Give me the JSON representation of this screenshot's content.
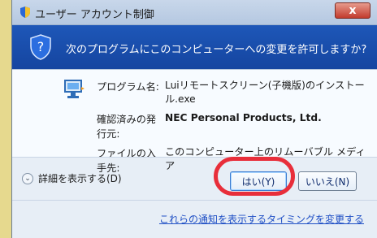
{
  "window": {
    "title": "ユーザー アカウント制御",
    "close_label": "x"
  },
  "header": {
    "text": "次のプログラムにこのコンピューターへの変更を許可しますか?"
  },
  "details": {
    "program_label": "プログラム名:",
    "program_value": "Luiリモートスクリーン(子機版)のインストール.exe",
    "publisher_label": "確認済みの発行元:",
    "publisher_value": "NEC Personal Products, Ltd.",
    "source_label": "ファイルの入手先:",
    "source_value": "このコンピューター上のリムーバブル メディア"
  },
  "actions": {
    "show_details": "詳細を表示する(D)",
    "yes": "はい(Y)",
    "no": "いいえ(N)"
  },
  "footer": {
    "link": "これらの通知を表示するタイミングを変更する"
  },
  "colors": {
    "header_blue": "#1b4fae",
    "highlight_red": "#e82e3a",
    "link_blue": "#1f4fc5"
  },
  "icons": {
    "title": "uac-shield-icon",
    "header": "uac-shield-icon",
    "program": "network-computer-icon"
  }
}
